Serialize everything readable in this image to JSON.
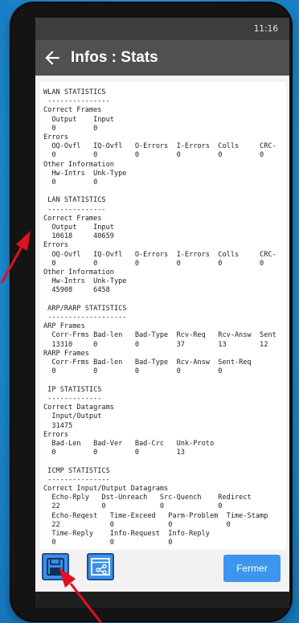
{
  "status_bar": {
    "time": "11:16"
  },
  "app_bar": {
    "title": "Infos : Stats",
    "back_icon": "arrow-left-icon"
  },
  "stats_text": "WLAN STATISTICS\n ---------------\nCorrect Frames\n  Output    Input\n  0         0\nErrors\n  OQ-Ovfl   IQ-Ovfl   O-Errors  I-Errors  Colls     CRC-\n  0         0         0         0         0         0\nOther Information\n  Hw-Intrs  Unk-Type\n  0         0\n\n LAN STATISTICS\n --------------\nCorrect Frames\n  Output    Input\n  10618     40659\nErrors\n  OQ-Ovfl   IQ-Ovfl   O-Errors  I-Errors  Colls     CRC-\n  0         0         0         0         0         0\nOther Information\n  Hw-Intrs  Unk-Type\n  45908     6458\n\n ARP/RARP STATISTICS\n -------------------\nARP Frames\n  Corr-Frms Bad-len   Bad-Type  Rcv-Req   Rcv-Answ  Sent\n  13310     0         0         37        13        12\nRARP Frames\n  Corr-Frms Bad-len   Bad-Type  Rcv-Answ  Sent-Req\n  0         0         0         0         0\n\n IP STATISTICS\n -------------\nCorrect Datagrams\n  Input/Output\n  31475\nErrors\n  Bad-Len   Bad-Ver   Bad-Crc   Unk-Proto\n  0         0         0         13\n\n ICMP STATISTICS\n ---------------\nCorrect Input/Output Datagrams\n  Echo-Rply   Dst-Unreach   Src-Quench    Redirect\n  22          0             0             0\n  Echo-Reqest   Time-Exceed   Parm-Problem  Time-Stamp\n  22            0             0             0\n  Time-Reply    Info-Request  Info-Reply\n  0             0             0",
  "bottom_bar": {
    "save_icon": "floppy-disk-icon",
    "share_icon": "share-window-icon",
    "close_label": "Fermer"
  },
  "colors": {
    "background": "#1f8fd3",
    "app_bar": "#505050",
    "status_bar": "#3d3d3d",
    "button": "#3d95ee",
    "annotation_arrow": "#e01020"
  }
}
